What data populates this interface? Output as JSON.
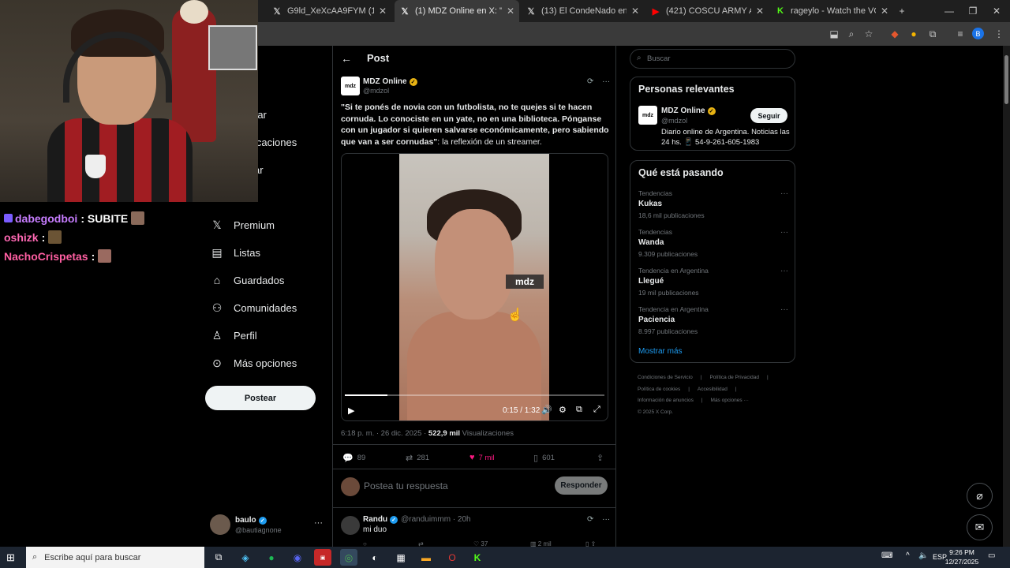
{
  "browser": {
    "tabs": [
      {
        "title": "G9ld_XeXcAA9FYM (1152×2048)",
        "icon": "image-icon"
      },
      {
        "title": "(1) MDZ Online en X: \"\"Si te po",
        "icon": "x-icon",
        "active": true
      },
      {
        "title": "(13) El CondeNado en X: \"jajaja",
        "icon": "x-icon"
      },
      {
        "title": "(421) COSCU ARMY AWARDS 2",
        "icon": "youtube-icon"
      },
      {
        "title": "rageylo - Watch the VOD o",
        "icon": "kick-icon"
      }
    ],
    "new_tab": "+",
    "window_controls": [
      "—",
      "❐",
      "✕"
    ]
  },
  "stream_chat": [
    {
      "user": "dabegodboi",
      "message": ": SUBITE",
      "color": "#c77dff"
    },
    {
      "user": "oshizk",
      "message": ":",
      "color": "#ff69b4"
    },
    {
      "user": "NachoCrispetas",
      "message": ":",
      "color": "#ff5fa2"
    }
  ],
  "nav": {
    "partial_items": [
      "rar",
      "icaciones",
      "ar"
    ],
    "items": [
      {
        "label": "Premium",
        "icon": "x-logo-icon"
      },
      {
        "label": "Listas",
        "icon": "list-icon"
      },
      {
        "label": "Guardados",
        "icon": "bookmark-icon"
      },
      {
        "label": "Comunidades",
        "icon": "communities-icon"
      },
      {
        "label": "Perfil",
        "icon": "profile-icon"
      },
      {
        "label": "Más opciones",
        "icon": "more-circle-icon"
      }
    ],
    "post_button": "Postear",
    "profile": {
      "name": "baulo",
      "handle": "@bautiagnone",
      "more": "···"
    }
  },
  "post": {
    "header_title": "Post",
    "author": {
      "name": "MDZ Online",
      "handle": "@mdzol",
      "avatar_text": "mdz"
    },
    "text_bold": "\"Si te ponés de novia con un futbolista, no te quejes si te hacen cornuda. Lo conociste en un yate, no en una biblioteca. Pónganse con un jugador si quieren salvarse económicamente, pero sabiendo que van a ser cornudas\"",
    "text_rest": ": la reflexión de un streamer.",
    "video": {
      "logo": "mdz",
      "time": "0:15 / 1:32",
      "progress": 0.163
    },
    "timestamp": "6:18 p. m. · 26 dic. 2025 · ",
    "views_count": "522,9 mil",
    "views_label": " Visualizaciones",
    "stats": {
      "replies": "89",
      "reposts": "281",
      "likes": "7 mil",
      "bookmarks": "601"
    },
    "reply_placeholder": "Postea tu respuesta",
    "reply_button": "Responder"
  },
  "comment": {
    "name": "Randu",
    "handle": "@randuimmm · 20h",
    "text": "mi duo",
    "likes": "37",
    "views": "2 mil"
  },
  "sidebar": {
    "search_placeholder": "Buscar",
    "relevant_title": "Personas relevantes",
    "relevant": {
      "name": "MDZ Online",
      "handle": "@mdzol",
      "bio": "Diario online de Argentina. Noticias las 24 hs. 📱 54-9-261-605-1983",
      "follow": "Seguir"
    },
    "trends_title": "Qué está pasando",
    "trends": [
      {
        "context": "Tendencias",
        "name": "Kukas",
        "count": "18,6 mil publicaciones"
      },
      {
        "context": "Tendencias",
        "name": "Wanda",
        "count": "9.309 publicaciones"
      },
      {
        "context": "Tendencia en Argentina",
        "name": "Llegué",
        "count": "19 mil publicaciones"
      },
      {
        "context": "Tendencia en Argentina",
        "name": "Paciencia",
        "count": "8.997 publicaciones"
      }
    ],
    "show_more": "Mostrar más",
    "footer": [
      "Condiciones de Servicio",
      "|",
      "Política de Privacidad",
      "|",
      "Política de cookies",
      "|",
      "Accesibilidad",
      "|",
      "Información de anuncios",
      "|",
      "Más opciones ···",
      "© 2025 X Corp."
    ]
  },
  "taskbar": {
    "search_placeholder": "Escribe aquí para buscar",
    "lang": "ESP",
    "time": "9:26 PM",
    "date": "12/27/2025"
  }
}
